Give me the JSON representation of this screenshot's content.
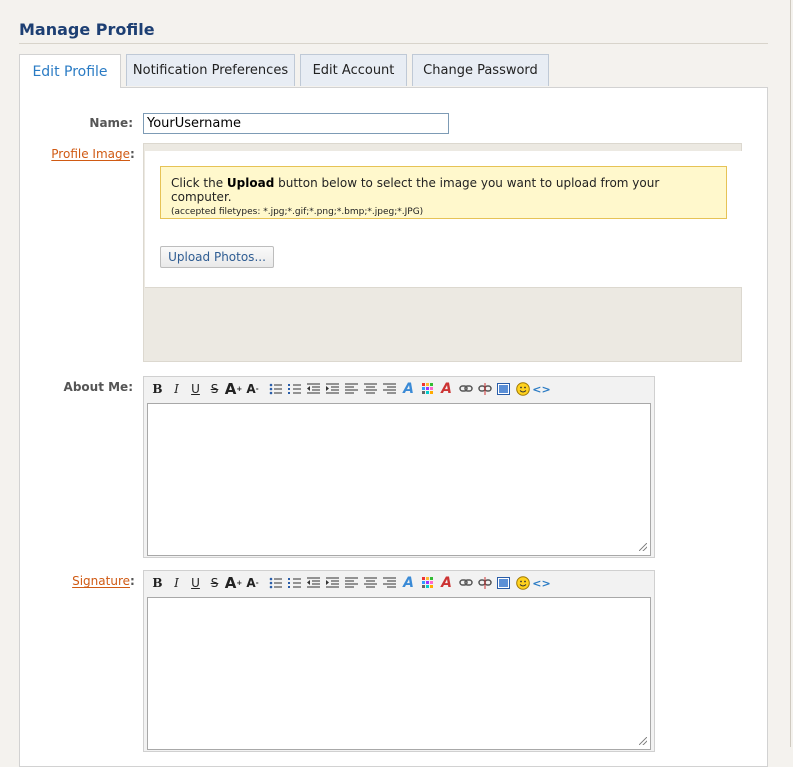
{
  "page": {
    "title": "Manage Profile"
  },
  "tabs": [
    {
      "label": "Edit Profile",
      "active": true
    },
    {
      "label": "Notification Preferences",
      "active": false
    },
    {
      "label": "Edit Account",
      "active": false
    },
    {
      "label": "Change Password",
      "active": false
    }
  ],
  "form": {
    "name_label": "Name:",
    "name_value": "YourUsername",
    "profile_image_label": "Profile Image",
    "about_label": "About Me:",
    "signature_label": "Signature",
    "colon": ":"
  },
  "upload": {
    "prefix": "Click the ",
    "bold": "Upload",
    "suffix": " button below to select the image you want to upload from your computer.",
    "filetypes": "(accepted filetypes: *.jpg;*.gif;*.png;*.bmp;*.jpeg;*.JPG)",
    "button_label": "Upload Photos..."
  },
  "toolbar_icons": [
    "bold-icon",
    "italic-icon",
    "underline-icon",
    "strikethrough-icon",
    "font-size-increase-icon",
    "font-size-decrease-icon",
    "bullet-list-icon",
    "numbered-list-icon",
    "outdent-icon",
    "indent-icon",
    "align-left-icon",
    "align-center-icon",
    "align-right-icon",
    "font-color-icon",
    "color-palette-icon",
    "background-color-icon",
    "insert-link-icon",
    "remove-link-icon",
    "insert-image-icon",
    "emoticon-icon",
    "source-code-icon"
  ],
  "colors": {
    "accent": "#2a7bc4",
    "title": "#1d3f73",
    "link": "#d05a13",
    "notice_bg": "#fff8cc"
  }
}
